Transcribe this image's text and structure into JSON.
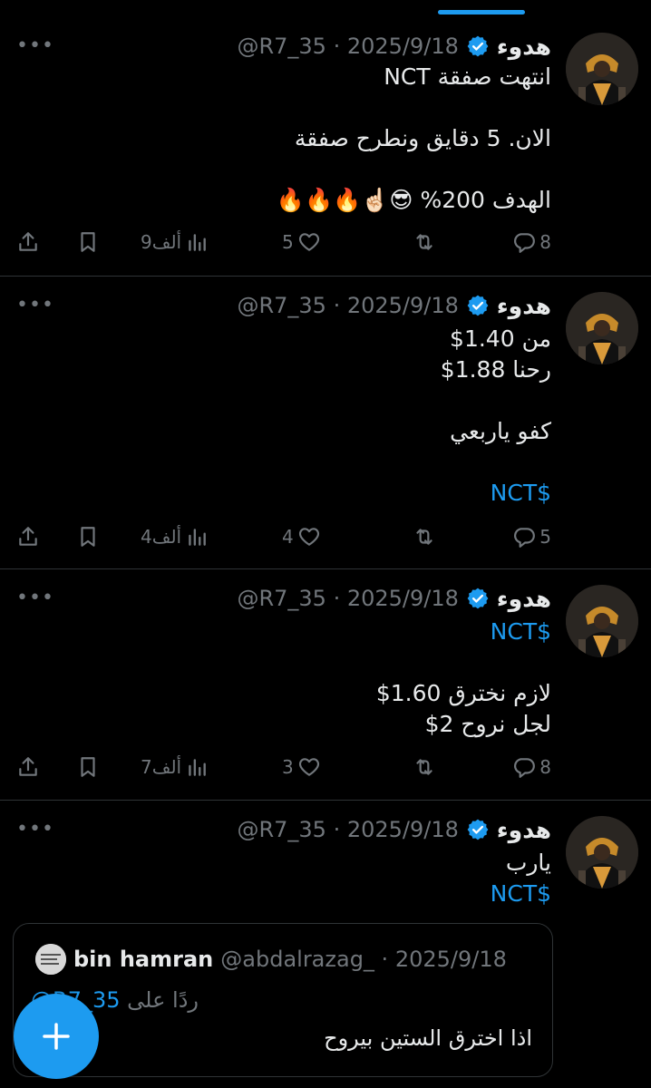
{
  "colors": {
    "background": "#000000",
    "accent": "#1d9bf0",
    "text": "#e7e9ea",
    "muted": "#71767b",
    "divider": "#2f3336"
  },
  "tweets": [
    {
      "name": "هدوء",
      "meta": "@R7_35 · 2025/9/18",
      "lines": [
        "انتهت صفقة NCT",
        "",
        "الان. 5 دقايق ونطرح صفقة",
        "",
        "الهدف 200% 😎☝🏻🔥🔥🔥"
      ],
      "stats": {
        "replies": "8",
        "reposts": "",
        "likes": "5",
        "views": "9ألف"
      }
    },
    {
      "name": "هدوء",
      "meta": "@R7_35 · 2025/9/18",
      "lines": [
        "من 1.40$",
        "رحنا 1.88$",
        "",
        "كفو ياربعي",
        "",
        "$NCT"
      ],
      "stats": {
        "replies": "5",
        "reposts": "",
        "likes": "4",
        "views": "4ألف"
      }
    },
    {
      "name": "هدوء",
      "meta": "@R7_35 · 2025/9/18",
      "lines": [
        "$NCT",
        "",
        "لازم نخترق 1.60$",
        "لجل نروح 2$"
      ],
      "stats": {
        "replies": "8",
        "reposts": "",
        "likes": "3",
        "views": "7ألف"
      }
    },
    {
      "name": "هدوء",
      "meta": "@R7_35 · 2025/9/18",
      "lines": [
        "يارب",
        "$NCT"
      ],
      "quote": {
        "name": "bin hamran",
        "meta": "@abdalrazag_ · 2025/9/18",
        "reply_prefix": "ردًا على",
        "reply_handle": "@R7_35",
        "text": "اذا اخترق الستين بيروح"
      }
    }
  ],
  "icons": {
    "more": "more-horizontal-icon",
    "verified": "verified-badge-icon",
    "reply": "reply-icon",
    "repost": "repost-icon",
    "like": "heart-icon",
    "views": "views-icon",
    "bookmark": "bookmark-icon",
    "share": "share-icon",
    "compose": "plus-icon"
  },
  "fab": {
    "label": "+"
  }
}
